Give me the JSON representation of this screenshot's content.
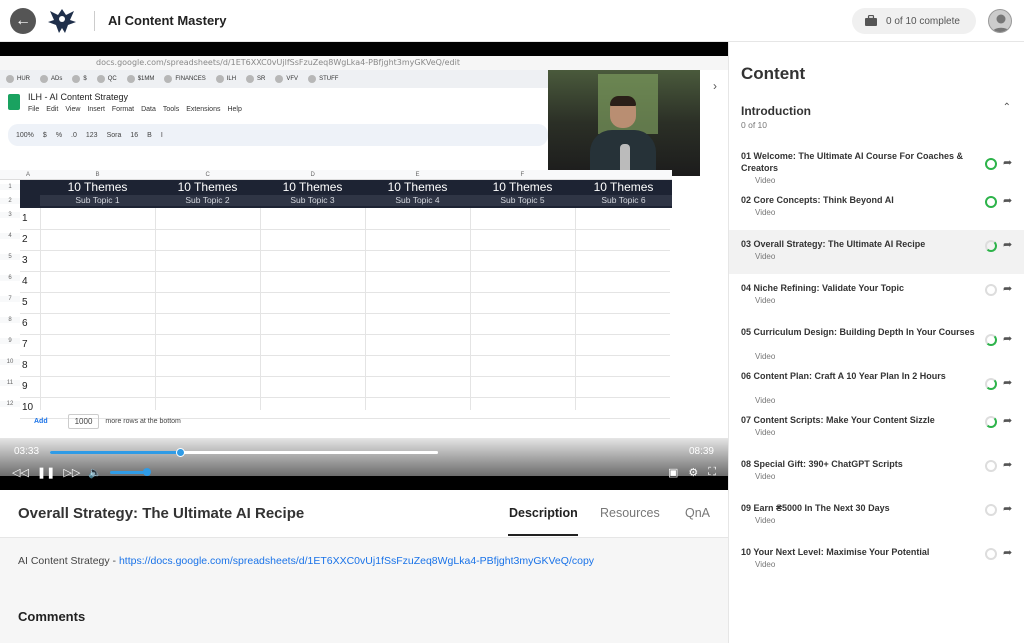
{
  "topbar": {
    "back_icon": "arrow-left-icon",
    "course_title": "AI Content Mastery",
    "progress_text": "0 of 10 complete"
  },
  "video": {
    "browser_url": "docs.google.com/spreadsheets/d/1ET6XXC0vUjlfSsFzuZeq8WgLka4-PBfjght3myGKVeQ/edit",
    "bookmarks": [
      "HUR",
      "ADs",
      "$",
      "QC",
      "$1MM",
      "FINANCES",
      "ILH",
      "SR",
      "VFV",
      "STUFF"
    ],
    "sheet": {
      "title": "ILH - AI Content Strategy",
      "menu": [
        "File",
        "Edit",
        "View",
        "Insert",
        "Format",
        "Data",
        "Tools",
        "Extensions",
        "Help"
      ],
      "toolbar": [
        "100%",
        "$",
        "%",
        ".0",
        "123",
        "Sora",
        "16",
        "B",
        "I"
      ],
      "col_letters": [
        "A",
        "B",
        "C",
        "D",
        "E",
        "F"
      ],
      "row_numbers": [
        "1",
        "2",
        "3",
        "4",
        "5",
        "6",
        "7",
        "8",
        "9",
        "10",
        "11",
        "12"
      ],
      "themes": [
        {
          "title": "10 Themes",
          "sub": "Sub Topic 1"
        },
        {
          "title": "10 Themes",
          "sub": "Sub Topic 2"
        },
        {
          "title": "10 Themes",
          "sub": "Sub Topic 3"
        },
        {
          "title": "10 Themes",
          "sub": "Sub Topic 4"
        },
        {
          "title": "10 Themes",
          "sub": "Sub Topic 5"
        },
        {
          "title": "10 Themes",
          "sub": "Sub Topic 6"
        }
      ],
      "numbers": [
        "1",
        "2",
        "3",
        "4",
        "5",
        "6",
        "7",
        "8",
        "9",
        "10"
      ],
      "add_label": "Add",
      "add_rows_value": "1000",
      "add_rows_suffix": "more rows at the bottom"
    },
    "time_elapsed": "03:33",
    "time_total": "08:39",
    "progress_fraction": 0.41,
    "buffered_fraction": 0.45,
    "volume_fraction": 0.9
  },
  "lesson": {
    "title": "Overall Strategy: The Ultimate AI Recipe",
    "tabs": [
      "Description",
      "Resources",
      "QnA"
    ],
    "active_tab": "Description",
    "description_prefix": "AI Content Strategy - ",
    "description_link": "https://docs.google.com/spreadsheets/d/1ET6XXC0vUj1fSsFzuZeq8WgLka4-PBfjght3myGKVeQ/copy",
    "comments_title": "Comments"
  },
  "sidebar": {
    "title": "Content",
    "section_title": "Introduction",
    "section_count": "0 of 10",
    "lessons": [
      {
        "name": "01  Welcome: The Ultimate AI Course For Coaches & Creators",
        "type": "Video",
        "status": "done"
      },
      {
        "name": "02  Core Concepts: Think Beyond AI",
        "type": "Video",
        "status": "done"
      },
      {
        "name": "03  Overall Strategy: The Ultimate AI Recipe",
        "type": "Video",
        "status": "partial"
      },
      {
        "name": "04  Niche Refining: Validate Your Topic",
        "type": "Video",
        "status": "none"
      },
      {
        "name": "05  Curriculum Design: Building Depth In Your Courses",
        "type": "Video",
        "status": "partial"
      },
      {
        "name": "06  Content Plan: Craft A 10 Year Plan In 2 Hours",
        "type": "Video",
        "status": "partial"
      },
      {
        "name": "07  Content Scripts: Make Your Content Sizzle",
        "type": "Video",
        "status": "partial"
      },
      {
        "name": "08  Special Gift: 390+ ChatGPT Scripts",
        "type": "Video",
        "status": "none"
      },
      {
        "name": "09  Earn ₴5000 In The Next 30 Days",
        "type": "Video",
        "status": "none"
      },
      {
        "name": "10  Your Next Level: Maximise Your Potential",
        "type": "Video",
        "status": "none"
      }
    ],
    "active_index": 2
  },
  "colors": {
    "accent": "#2f9be6",
    "complete_green": "#2db34a",
    "sheet_header": "#1d2333",
    "link": "#1a73e8"
  }
}
